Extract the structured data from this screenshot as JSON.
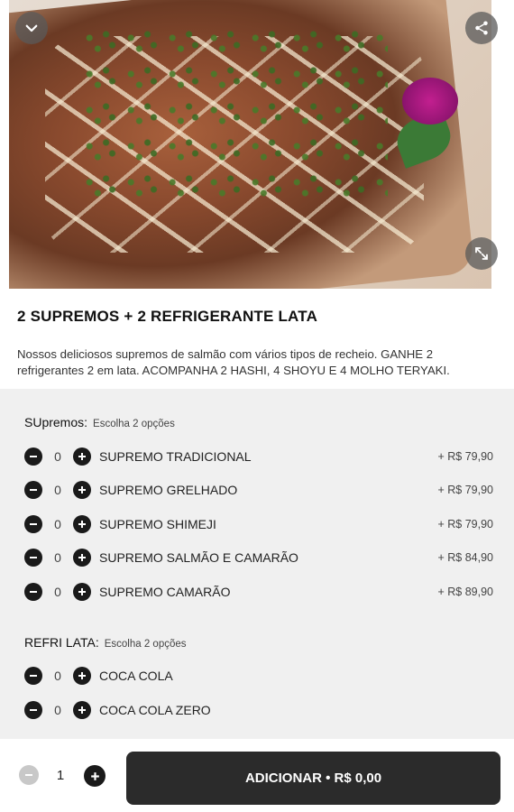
{
  "product": {
    "title": "2 SUPREMOS + 2 REFRIGERANTE LATA",
    "description": "Nossos deliciosos supremos de salmão com vários tipos de recheio. GANHE 2 refrigerantes 2 em lata. ACOMPANHA 2 HASHI, 4 SHOYU E 4 MOLHO TERYAKI."
  },
  "icons": {
    "back": "chevron-down-icon",
    "share": "share-icon",
    "expand": "expand-icon",
    "minus": "minus-circle-icon",
    "plus": "plus-circle-icon"
  },
  "groups": [
    {
      "name": "SUpremos:",
      "hint": "Escolha 2 opções",
      "items": [
        {
          "qty": "0",
          "name": "SUPREMO TRADICIONAL",
          "price": "+ R$ 79,90"
        },
        {
          "qty": "0",
          "name": "SUPREMO GRELHADO",
          "price": "+ R$ 79,90"
        },
        {
          "qty": "0",
          "name": "SUPREMO SHIMEJI",
          "price": "+ R$ 79,90"
        },
        {
          "qty": "0",
          "name": "SUPREMO SALMÃO E CAMARÃO",
          "price": "+ R$ 84,90"
        },
        {
          "qty": "0",
          "name": "SUPREMO CAMARÃO",
          "price": "+ R$ 89,90"
        }
      ]
    },
    {
      "name": "REFRI LATA:",
      "hint": "Escolha 2 opções",
      "items": [
        {
          "qty": "0",
          "name": "COCA COLA",
          "price": ""
        },
        {
          "qty": "0",
          "name": "COCA COLA ZERO",
          "price": ""
        }
      ]
    }
  ],
  "footer": {
    "quantity": "1",
    "add_label": "ADICIONAR • R$ 0,00"
  },
  "colors": {
    "dark_button": "#2b2b2b",
    "options_bg": "#f0f0f0",
    "disabled": "#c8c8c8"
  }
}
